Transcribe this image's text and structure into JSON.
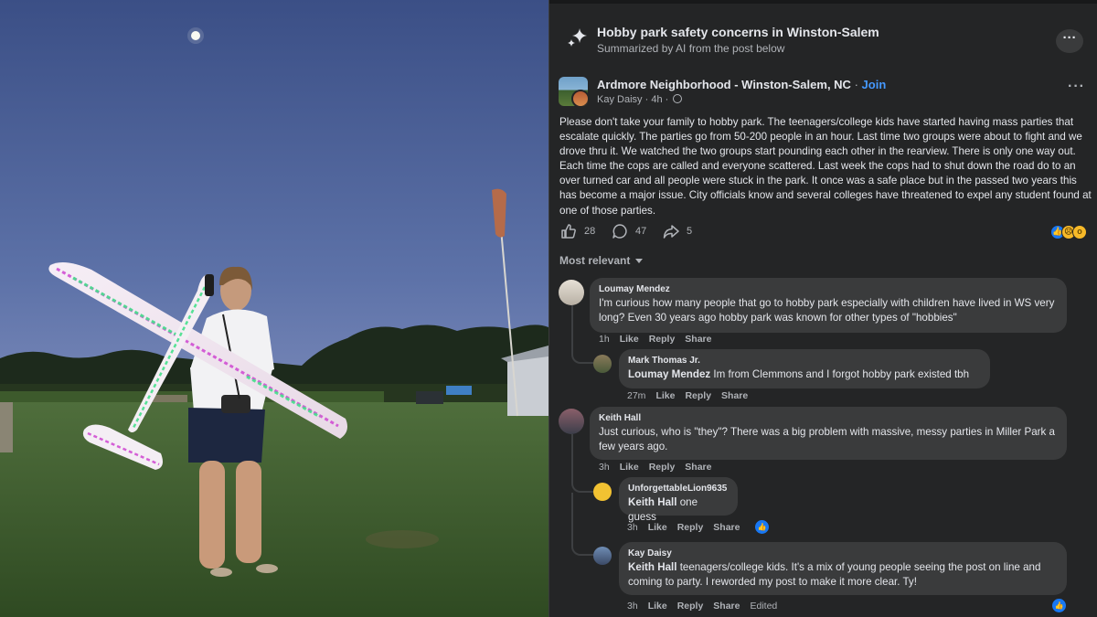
{
  "panel": {
    "ai_summary": {
      "title": "Hobby park safety concerns in Winston-Salem",
      "subtitle": "Summarized by AI from the post below",
      "more_icon": "ellipsis-icon"
    },
    "post": {
      "group_name": "Ardmore Neighborhood - Winston-Salem, NC",
      "separator": "·",
      "join_label": "Join",
      "author": "Kay Daisy",
      "time": "4h",
      "privacy_icon": "globe-icon",
      "body": "Please don't take your family to hobby park. The teenagers/college kids have started having mass parties that escalate quickly. The parties go from 50-200 people in an hour. Last time two groups were about to fight and we drove thru it. We watched the two groups start pounding each other in the rearview. There is only one way out. Each time the cops are called and everyone scattered. Last week the cops had to shut down the road do to an over turned car and all people were stuck in the park. It once was a safe place but in the passed two years this has become a major issue. City officials know and several colleges have threatened to expel any student found at one of those parties.",
      "likes": "28",
      "comments": "47",
      "shares": "5"
    },
    "sort_label": "Most relevant",
    "comments": [
      {
        "name": "Loumay Mendez",
        "text": "I'm curious how many people that go to hobby park especially with children have lived in WS very long? Even 30 years ago hobby park was known for other types of \"hobbies\"",
        "time": "1h",
        "like": "Like",
        "reply": "Reply",
        "share": "Share"
      },
      {
        "name": "Mark Thomas Jr.",
        "mention": "Loumay Mendez",
        "text": " Im from Clemmons and I forgot hobby park existed tbh",
        "time": "27m",
        "like": "Like",
        "reply": "Reply",
        "share": "Share"
      },
      {
        "name": "Keith Hall",
        "text": "Just curious, who is \"they\"? There was a big problem with massive, messy parties in Miller Park a few years ago.",
        "time": "3h",
        "like": "Like",
        "reply": "Reply",
        "share": "Share"
      },
      {
        "name": "UnforgettableLion9635",
        "mention": "Keith Hall",
        "text": " one guess",
        "time": "3h",
        "like": "Like",
        "reply": "Reply",
        "share": "Share"
      },
      {
        "name": "Kay Daisy",
        "mention": "Keith Hall",
        "text": " teenagers/college kids. It's a mix of young people seeing the post on line and coming to party. I reworded my post to make it more clear. Ty!",
        "time": "3h",
        "like": "Like",
        "reply": "Reply",
        "share": "Share",
        "edited": "Edited"
      }
    ]
  },
  "colors": {
    "panel_bg": "#242526",
    "bubble_bg": "#3a3b3c",
    "link_blue": "#4599ff",
    "like_blue": "#1877f2",
    "text_primary": "#e4e6eb",
    "text_secondary": "#b0b3b8"
  }
}
